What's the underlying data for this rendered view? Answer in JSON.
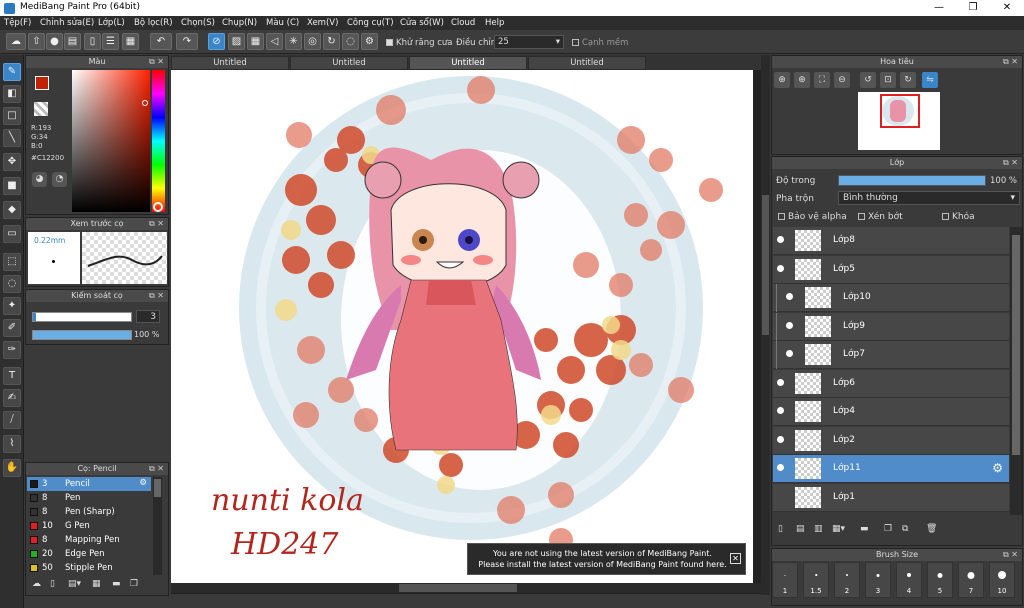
{
  "window": {
    "title": "MediBang Paint Pro (64bit)"
  },
  "menu": [
    "Tệp(F)",
    "Chỉnh sửa(E)",
    "Lớp(L)",
    "Bộ lọc(R)",
    "Chọn(S)",
    "Chụp(N)",
    "Màu (C)",
    "Xem(V)",
    "Công cụ(T)",
    "Cửa sổ(W)",
    "Cloud",
    "Help"
  ],
  "toolbar": {
    "antialias_label": "Khử răng cưa",
    "adjust_label": "Điều chỉnh",
    "adjust_value": "25",
    "edge_label": "Cạnh mềm"
  },
  "color_panel": {
    "title": "Màu",
    "r": "R:193",
    "g": "G:34",
    "b": "B:0",
    "hex": "#C12200",
    "fg_color": "#C12200"
  },
  "brush_preview": {
    "title": "Xem trước cọ",
    "size": "0.22mm"
  },
  "brush_control": {
    "title": "Kiểm soát cọ",
    "size_value": "3",
    "opacity_value": "100 %"
  },
  "brush_list": {
    "title": "Cọ: Pencil",
    "items": [
      {
        "size": "3",
        "name": "Pencil",
        "color": "#1a1a1a"
      },
      {
        "size": "8",
        "name": "Pen",
        "color": "#333333"
      },
      {
        "size": "8",
        "name": "Pen (Sharp)",
        "color": "#333333"
      },
      {
        "size": "10",
        "name": "G Pen",
        "color": "#e02020"
      },
      {
        "size": "8",
        "name": "Mapping Pen",
        "color": "#e02020"
      },
      {
        "size": "20",
        "name": "Edge Pen",
        "color": "#20b020"
      },
      {
        "size": "50",
        "name": "Stipple Pen",
        "color": "#e0c020"
      }
    ]
  },
  "tabs": [
    "Untitled",
    "Untitled",
    "Untitled",
    "Untitled"
  ],
  "canvas": {
    "signature_line1": "nunti kola",
    "signature_line2": "HD247"
  },
  "notification": {
    "line1": "You are not using the latest version of MediBang Paint.",
    "line2": "Please install the latest version of MediBang Paint found here."
  },
  "navigator": {
    "title": "Hoa tiêu"
  },
  "layers": {
    "title": "Lớp",
    "opacity_label": "Độ trong",
    "opacity_value": "100 %",
    "opacity_fraction": 1.0,
    "blend_label": "Pha trộn",
    "blend_value": "Bình thường",
    "protect_alpha": "Bảo vệ alpha",
    "clipping": "Xén bớt",
    "lock": "Khóa",
    "items": [
      {
        "name": "Lớp8",
        "indent": false,
        "visible": true
      },
      {
        "name": "Lớp5",
        "indent": false,
        "visible": true
      },
      {
        "name": "Lớp10",
        "indent": true,
        "visible": true
      },
      {
        "name": "Lớp9",
        "indent": true,
        "visible": true
      },
      {
        "name": "Lớp7",
        "indent": true,
        "visible": true
      },
      {
        "name": "Lớp6",
        "indent": false,
        "visible": true
      },
      {
        "name": "Lớp4",
        "indent": false,
        "visible": true
      },
      {
        "name": "Lớp2",
        "indent": false,
        "visible": true
      },
      {
        "name": "Lớp11",
        "indent": false,
        "visible": true,
        "selected": true
      },
      {
        "name": "Lớp1",
        "indent": false,
        "visible": false
      }
    ]
  },
  "brush_size": {
    "title": "Brush Size",
    "sizes": [
      "1",
      "1.5",
      "2",
      "3",
      "4",
      "5",
      "7",
      "10"
    ]
  }
}
